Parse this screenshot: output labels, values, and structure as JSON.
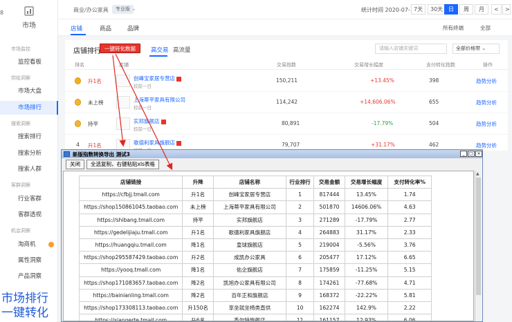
{
  "nav": {
    "edge_label": "8",
    "title": "市场",
    "groups": [
      {
        "label": "市场监控",
        "items": [
          "监控看板"
        ]
      },
      {
        "label": "供给洞察",
        "items": [
          "市场大盘",
          "市场排行"
        ]
      },
      {
        "label": "搜索洞察",
        "items": [
          "搜索排行",
          "搜索分析",
          "搜索人群"
        ]
      },
      {
        "label": "客群洞察",
        "items": [
          "行业客群",
          "客群透视"
        ]
      },
      {
        "label": "机会洞察",
        "items": [
          "淘商机",
          "属性洞察",
          "产品洞察"
        ]
      }
    ],
    "active_item": "市场排行",
    "promo_line1": "市场排行",
    "promo_line2": "一键转化"
  },
  "topbar": {
    "breadcrumb": "商业/办公家具",
    "badge": "专业版",
    "stat_time": "统计时间 2020-07-15",
    "periods": [
      "7天",
      "30天",
      "日",
      "周",
      "月"
    ],
    "active_period": "日",
    "prev": "<",
    "next": ">"
  },
  "subtabs": {
    "tabs": [
      "店铺",
      "商品",
      "品牌"
    ],
    "active": "店铺",
    "filter_terminal": "所有终端",
    "filter_all": "全部"
  },
  "panel": {
    "title": "店铺排行",
    "convert_button": "一键转化数据",
    "tabs": [
      "高交易",
      "高流量"
    ],
    "active_tab": "高交易",
    "search_placeholder": "请输入店铺关键词",
    "sort_label": "全部价格带",
    "headers": [
      "排名",
      "店铺",
      "交易指数",
      "交易增长幅度",
      "支付转化指数",
      "操作"
    ],
    "rows": [
      {
        "rank": "1",
        "change": "升1名",
        "shop": "创峰宝家居专营店",
        "sub": "较前一日",
        "trade": "150,211",
        "growth": "+13.45%",
        "conv": "398",
        "op": "趋势分析"
      },
      {
        "rank": "2",
        "change": "未上榜",
        "shop": "上海蒂平家具有限公司",
        "sub": "较前一日",
        "trade": "114,242",
        "growth": "+14,606.06%",
        "conv": "655",
        "op": "趋势分析"
      },
      {
        "rank": "3",
        "change": "持平",
        "shop": "实邦旗舰店",
        "sub": "较前一日",
        "trade": "80,891",
        "growth": "-17.79%",
        "conv": "504",
        "op": "趋势分析"
      },
      {
        "rank": "4",
        "change": "升1名",
        "shop": "歌德利家具旗舰店",
        "sub": "较前一日",
        "trade": "79,707",
        "growth": "+31.17%",
        "conv": "462",
        "op": "趋势分析"
      }
    ]
  },
  "popup": {
    "title": "新版指数转换导出  测试3",
    "btn_close": "关闭",
    "btn_copy": "全选复制，右键粘贴xls表格",
    "headers": [
      "店铺链接",
      "升降",
      "店铺名称",
      "行业排行",
      "交易金额",
      "交易增长幅度",
      "支付转化率%"
    ],
    "rows": [
      [
        "https://cfbjj.tmall.com",
        "升1名",
        "创峰宝家居专营店",
        "1",
        "817444",
        "13.45%",
        "1.74"
      ],
      [
        "https://shop150861045.taobao.com",
        "未上榜",
        "上海蒂平家具有限公司",
        "2",
        "501870",
        "14606.06%",
        "4.63"
      ],
      [
        "https://shibang.tmall.com",
        "持平",
        "实邦旗舰店",
        "3",
        "271289",
        "-17.79%",
        "2.77"
      ],
      [
        "https://gedelijiaju.tmall.com",
        "升1名",
        "歌德利家具旗舰店",
        "4",
        "264883",
        "31.17%",
        "2.33"
      ],
      [
        "https://huangqiu.tmall.com",
        "降1名",
        "皇球旗舰店",
        "5",
        "219004",
        "-5.56%",
        "3.76"
      ],
      [
        "https://shop295587429.taobao.com",
        "升2名",
        "成凯办公家具",
        "6",
        "205477",
        "17.12%",
        "6.65"
      ],
      [
        "https://yooq.tmall.com",
        "降1名",
        "佑企旗舰店",
        "7",
        "175859",
        "-11.25%",
        "5.15"
      ],
      [
        "https://shop171083657.taobao.com",
        "降2名",
        "凯旭办公家具有限公司",
        "8",
        "174261",
        "-77.68%",
        "4.71"
      ],
      [
        "https://bainianling.tmall.com",
        "降2名",
        "百年正和旗舰店",
        "9",
        "168372",
        "-22.22%",
        "5.81"
      ],
      [
        "https://shop173308113.taobao.com",
        "升150名",
        "享坐就坐椅类直供",
        "10",
        "162274",
        "142.9%",
        "2.22"
      ],
      [
        "https://xiangerte.tmall.com",
        "升6名",
        "香尔特旗舰店",
        "11",
        "161157",
        "12.93%",
        "6.06"
      ]
    ]
  },
  "colors": {
    "accent": "#1a66ff",
    "up": "#e8342e",
    "down": "#2ba245",
    "promo": "#1f5ad8"
  }
}
